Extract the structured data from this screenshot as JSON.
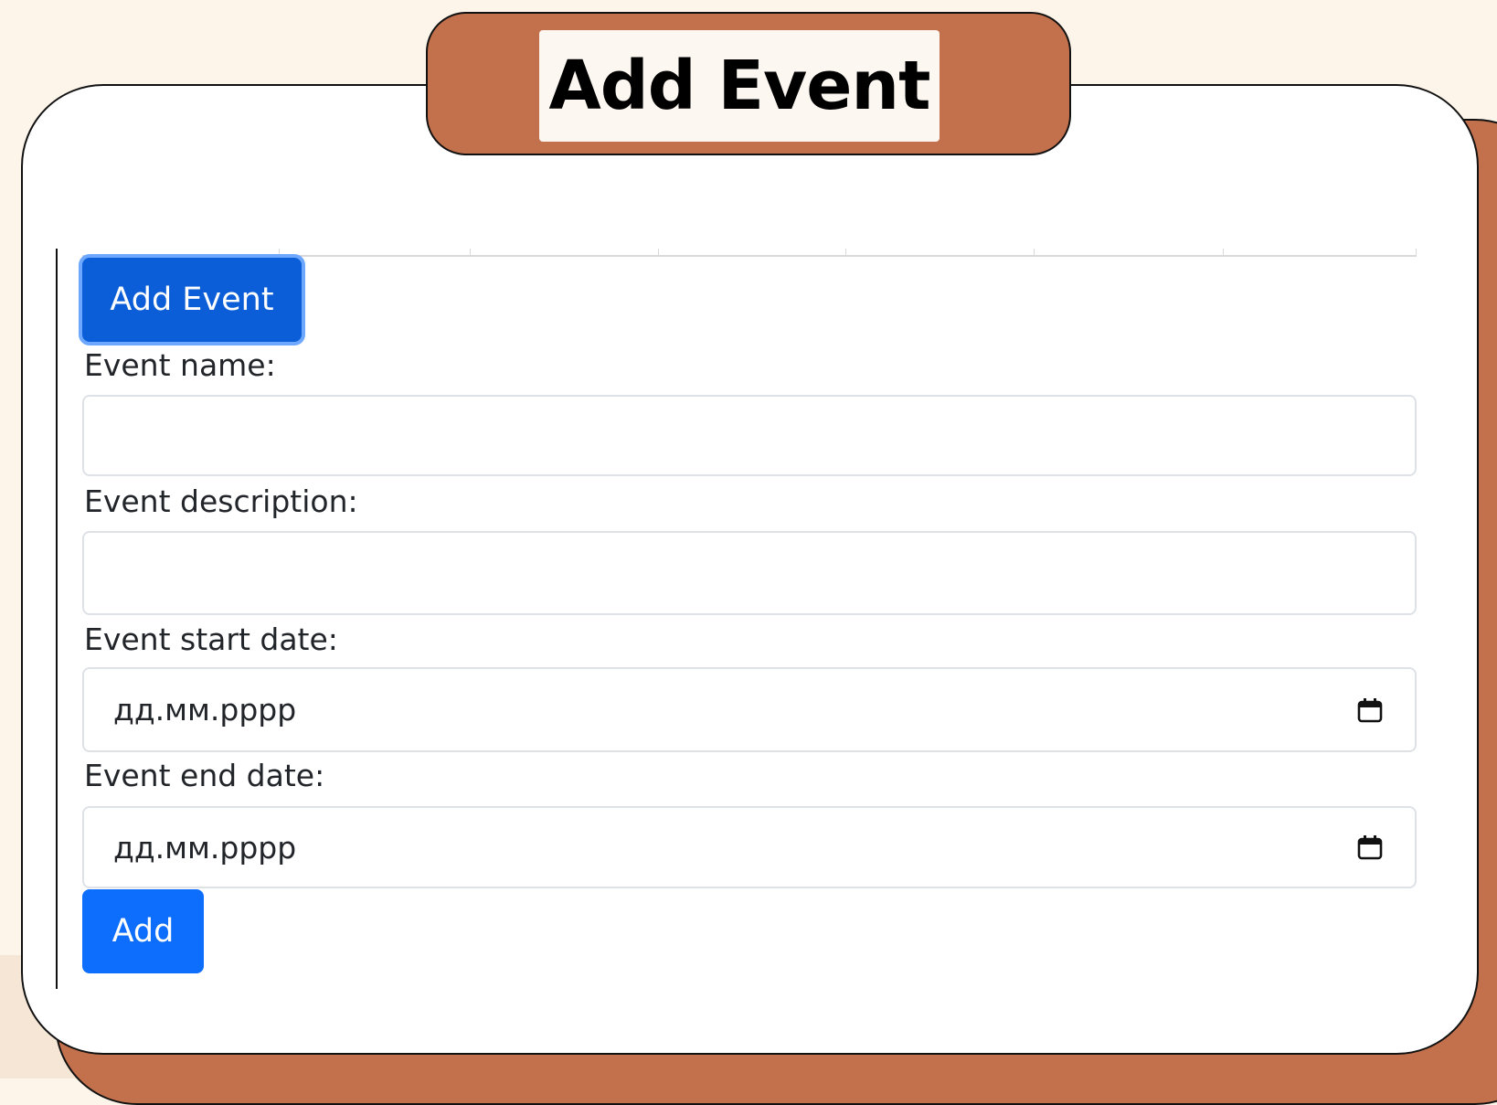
{
  "header": {
    "title": "Add Event"
  },
  "form": {
    "toggle_button_label": "Add Event",
    "name_label": "Event name:",
    "name_value": "",
    "description_label": "Event description:",
    "description_value": "",
    "start_date_label": "Event start date:",
    "start_date_placeholder": "дд.мм.рррр",
    "end_date_label": "Event end date:",
    "end_date_placeholder": "дд.мм.рррр",
    "submit_label": "Add"
  },
  "icons": {
    "date_picker": "calendar-icon"
  },
  "colors": {
    "accent_brown": "#c3714c",
    "primary_button": "#0d6efd",
    "primary_button_active": "#0b5ed7",
    "focus_ring": "#6ea8fe",
    "background": "#fdf4ea"
  }
}
